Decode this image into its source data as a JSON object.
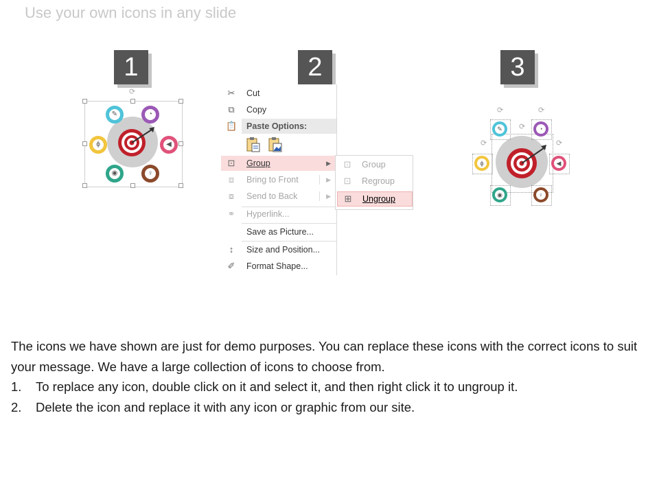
{
  "slide": {
    "title": "Use your own icons in any slide"
  },
  "steps": [
    "1",
    "2",
    "3"
  ],
  "context_menu": {
    "items": [
      {
        "id": "cut",
        "label": "Cut",
        "icon": "scissors-icon",
        "disabled": false
      },
      {
        "id": "copy",
        "label": "Copy",
        "icon": "copy-icon",
        "disabled": false
      },
      {
        "id": "paste_options",
        "label": "Paste Options:",
        "icon": "clipboard-icon",
        "disabled": false
      },
      {
        "id": "group",
        "label": "Group",
        "icon": "group-icon",
        "disabled": false,
        "highlighted": true
      },
      {
        "id": "bring_to_front",
        "label": "Bring to Front",
        "icon": "bring-front-icon",
        "disabled": true
      },
      {
        "id": "send_to_back",
        "label": "Send to Back",
        "icon": "send-back-icon",
        "disabled": true
      },
      {
        "id": "hyperlink",
        "label": "Hyperlink...",
        "icon": "link-icon",
        "disabled": true
      },
      {
        "id": "save_as_picture",
        "label": "Save as Picture...",
        "icon": "",
        "disabled": false
      },
      {
        "id": "size_position",
        "label": "Size and Position...",
        "icon": "size-icon",
        "disabled": false
      },
      {
        "id": "format_shape",
        "label": "Format Shape...",
        "icon": "format-shape-icon",
        "disabled": false
      }
    ],
    "submenu": [
      {
        "id": "group",
        "label": "Group",
        "disabled": true
      },
      {
        "id": "regroup",
        "label": "Regroup",
        "disabled": true
      },
      {
        "id": "ungroup",
        "label": "Ungroup",
        "disabled": false,
        "highlighted": true
      }
    ]
  },
  "icon_colors": {
    "cyan": "#4fc3d9",
    "purple": "#9b59b6",
    "pink": "#e0527a",
    "yellow": "#f2c53d",
    "teal": "#2fa58a",
    "brown": "#8b4a2b",
    "target_red": "#c0202a"
  },
  "body": {
    "paragraph": "The icons we have shown are just for demo purposes. You can replace these icons with the correct icons to suit your message. We have a large collection of icons to choose from.",
    "list": [
      {
        "num": "1.",
        "text": "To replace any icon, double click on it and select it, and then right click it to ungroup it."
      },
      {
        "num": "2.",
        "text": "Delete the icon and replace it with any icon or graphic from our site."
      }
    ]
  }
}
